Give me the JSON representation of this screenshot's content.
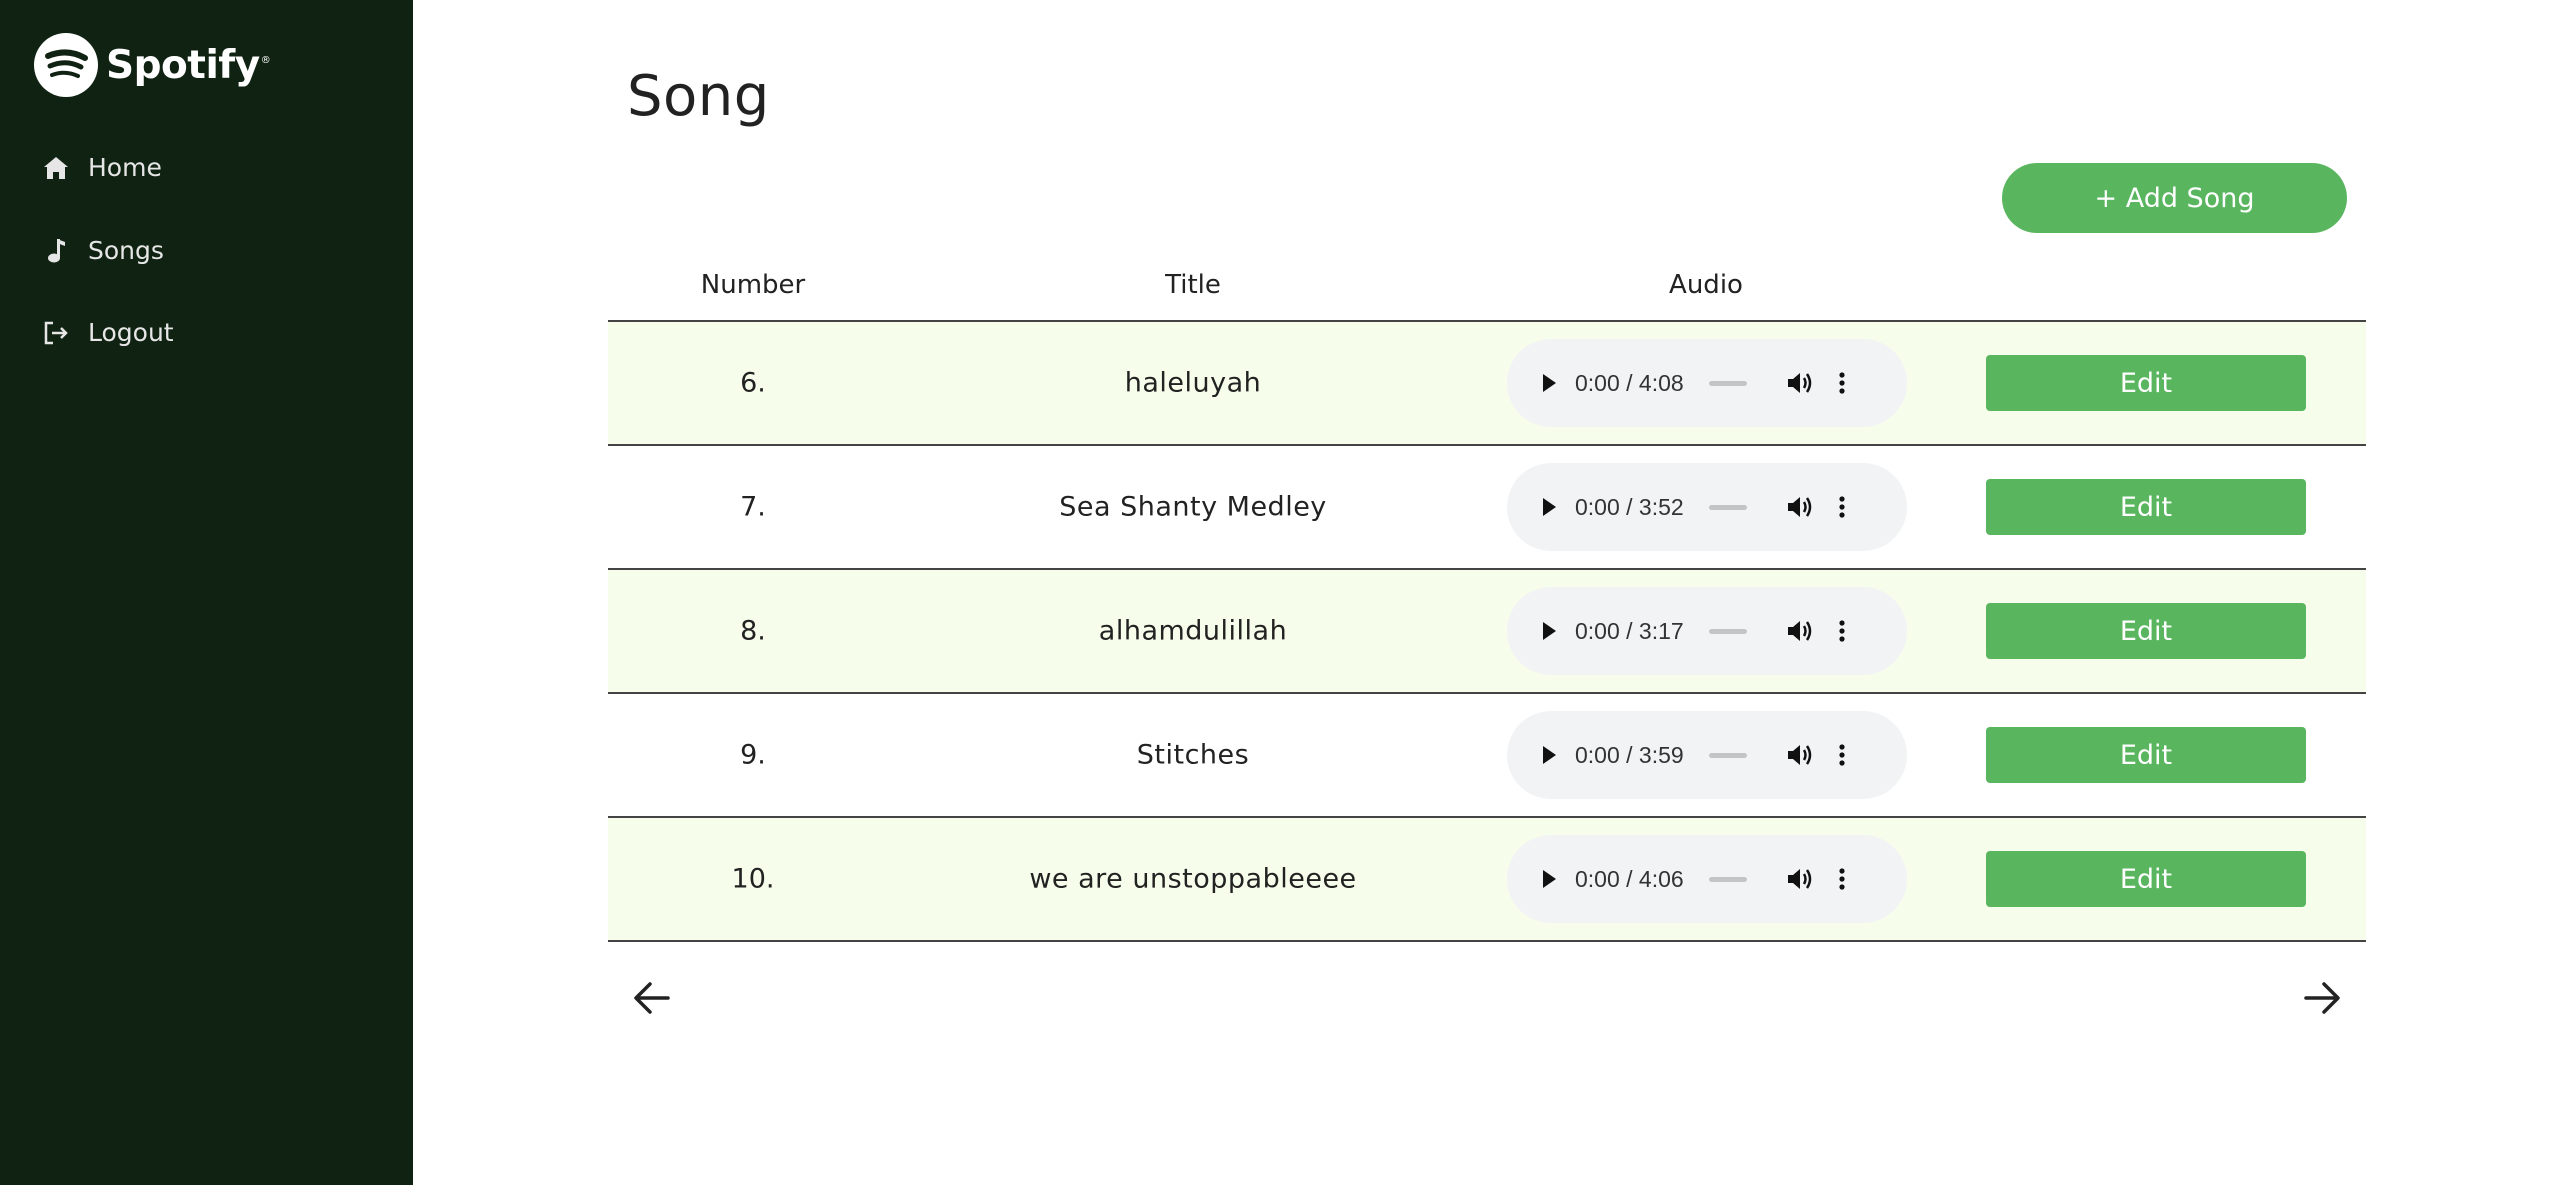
{
  "brand": {
    "name": "Spotify",
    "trademark": "®",
    "logo_icon": "spotify-logo-icon"
  },
  "nav": [
    {
      "label": "Home",
      "icon": "home-icon"
    },
    {
      "label": "Songs",
      "icon": "music-note-icon"
    },
    {
      "label": "Logout",
      "icon": "logout-icon"
    }
  ],
  "page": {
    "title": "Song"
  },
  "toolbar": {
    "add_label": "+ Add Song"
  },
  "table": {
    "headers": {
      "number": "Number",
      "title": "Title",
      "audio": "Audio"
    },
    "rows": [
      {
        "number": "6.",
        "title": "haleluyah",
        "time": "0:00 / 4:08",
        "edit_label": "Edit"
      },
      {
        "number": "7.",
        "title": "Sea Shanty Medley",
        "time": "0:00 / 3:52",
        "edit_label": "Edit"
      },
      {
        "number": "8.",
        "title": "alhamdulillah",
        "time": "0:00 / 3:17",
        "edit_label": "Edit"
      },
      {
        "number": "9.",
        "title": "Stitches",
        "time": "0:00 / 3:59",
        "edit_label": "Edit"
      },
      {
        "number": "10.",
        "title": "we are unstoppableeee",
        "time": "0:00 / 4:06",
        "edit_label": "Edit"
      }
    ]
  },
  "pagination": {
    "prev_icon": "arrow-left-icon",
    "next_icon": "arrow-right-icon"
  },
  "colors": {
    "sidebar": "#102313",
    "accent": "#59b65f",
    "row_alt": "#f6feeb",
    "player_bg": "#f1f3f4"
  }
}
